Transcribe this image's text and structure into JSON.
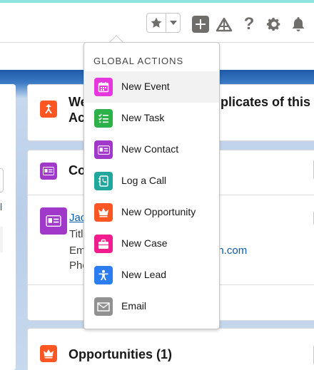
{
  "header": {
    "icons": [
      "star-icon",
      "chevron-down-icon",
      "plus-icon",
      "trailhead-icon",
      "help-icon",
      "gear-icon",
      "bell-icon"
    ],
    "help_glyph": "?"
  },
  "global_actions": {
    "heading": "GLOBAL ACTIONS",
    "items": [
      {
        "label": "New Event",
        "icon": "calendar-icon",
        "color": "#e637df"
      },
      {
        "label": "New Task",
        "icon": "task-icon",
        "color": "#2db14a"
      },
      {
        "label": "New Contact",
        "icon": "contact-icon",
        "color": "#a039c9"
      },
      {
        "label": "Log a Call",
        "icon": "phone-icon",
        "color": "#21a79d"
      },
      {
        "label": "New Opportunity",
        "icon": "crown-icon",
        "color": "#fc5723"
      },
      {
        "label": "New Case",
        "icon": "briefcase-icon",
        "color": "#f21c8c"
      },
      {
        "label": "New Lead",
        "icon": "lead-icon",
        "color": "#2b7df0"
      },
      {
        "label": "Email",
        "icon": "email-icon",
        "color": "#919191"
      }
    ]
  },
  "cards": {
    "duplicates": {
      "title_line1_start": "We",
      "title_line1_end": "plicates of this",
      "title_line2": "Ac"
    },
    "contacts": {
      "title": "Co"
    },
    "contact": {
      "name": "Jac",
      "line1": "Titl",
      "line2": "Em",
      "email_tail": "on.com",
      "line3": "Pho"
    },
    "opportunities": {
      "title": "Opportunities (1)"
    }
  },
  "left": {
    "link_text": "l"
  },
  "colors": {
    "brand": "#0b5cab",
    "top_strip": "#8fe3df",
    "opportunity": "#fc5723",
    "contact": "#a039c9"
  }
}
